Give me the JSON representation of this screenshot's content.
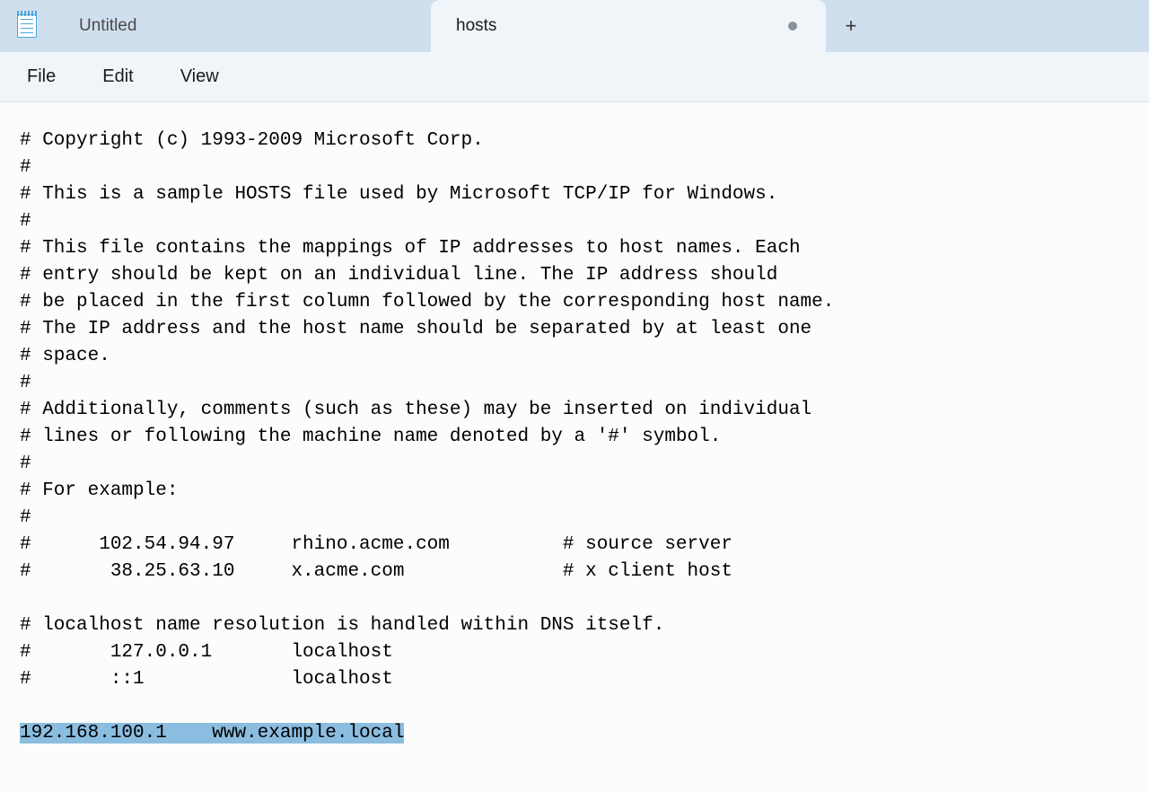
{
  "tabs": [
    {
      "title": "Untitled",
      "active": false,
      "modified": false
    },
    {
      "title": "hosts",
      "active": true,
      "modified": true
    }
  ],
  "menubar": {
    "file": "File",
    "edit": "Edit",
    "view": "View"
  },
  "editor": {
    "lines": [
      "# Copyright (c) 1993-2009 Microsoft Corp.",
      "#",
      "# This is a sample HOSTS file used by Microsoft TCP/IP for Windows.",
      "#",
      "# This file contains the mappings of IP addresses to host names. Each",
      "# entry should be kept on an individual line. The IP address should",
      "# be placed in the first column followed by the corresponding host name.",
      "# The IP address and the host name should be separated by at least one",
      "# space.",
      "#",
      "# Additionally, comments (such as these) may be inserted on individual",
      "# lines or following the machine name denoted by a '#' symbol.",
      "#",
      "# For example:",
      "#",
      "#      102.54.94.97     rhino.acme.com          # source server",
      "#       38.25.63.10     x.acme.com              # x client host",
      "",
      "# localhost name resolution is handled within DNS itself.",
      "#       127.0.0.1       localhost",
      "#       ::1             localhost",
      ""
    ],
    "selected_line": "192.168.100.1    www.example.local"
  }
}
